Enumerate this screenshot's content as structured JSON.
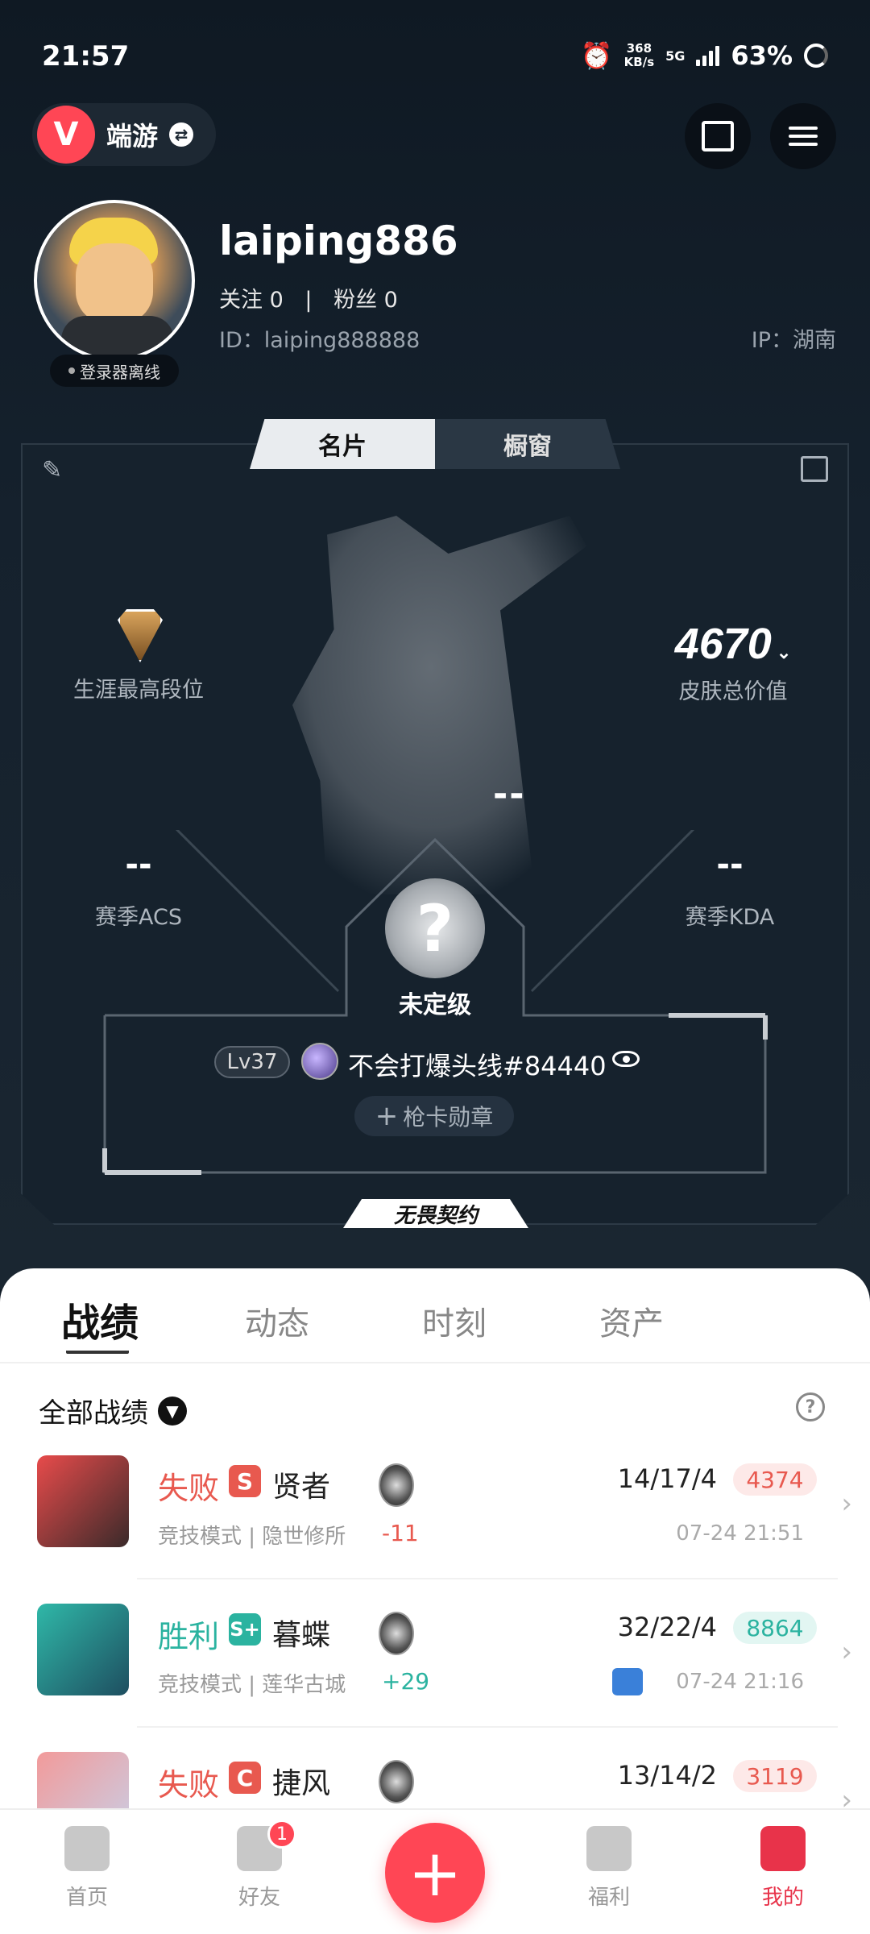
{
  "status_bar": {
    "time": "21:57",
    "net_speed_value": "368",
    "net_speed_unit": "KB/s",
    "network": "5G",
    "battery": "63%"
  },
  "header": {
    "app_name": "端游",
    "logo_icon": "valorant-logo-icon",
    "brand_color": "#ff4655"
  },
  "profile": {
    "username": "laiping886",
    "follow_label": "关注",
    "follow_count": "0",
    "separator": "|",
    "fans_label": "粉丝",
    "fans_count": "0",
    "id_text": "ID：laiping888888",
    "ip_text": "IP：湖南",
    "online_status": "登录器离线"
  },
  "card": {
    "tabs": [
      "名片",
      "橱窗"
    ],
    "active_tab": "名片",
    "career_rank_label": "生涯最高段位",
    "skin_value": "4670",
    "skin_value_label": "皮肤总价值",
    "center_dashes": "--",
    "acs_value": "--",
    "acs_label": "赛季ACS",
    "kda_value": "--",
    "kda_label": "赛季KDA",
    "rank_status_symbol": "?",
    "rank_status": "未定级",
    "level": "Lv37",
    "player_name": "不会打爆头线#84440",
    "badge_button": "枪卡勋章",
    "banner": "无畏契约"
  },
  "record_tabs": [
    "战绩",
    "动态",
    "时刻",
    "资产"
  ],
  "filter": {
    "label": "全部战绩"
  },
  "matches": [
    {
      "result": "失败",
      "tier": "S",
      "agent": "贤者",
      "mode": "竞技模式",
      "map": "隐世修所",
      "mode_map": "竞技模式 | 隐世修所",
      "rr_change": "-11",
      "kda": "14/17/4",
      "score": "4374",
      "time": "07-24 21:51",
      "has_video": false
    },
    {
      "result": "胜利",
      "tier": "S+",
      "agent": "暮蝶",
      "mode": "竞技模式",
      "map": "莲华古城",
      "mode_map": "竞技模式 | 莲华古城",
      "rr_change": "+29",
      "kda": "32/22/4",
      "score": "8864",
      "time": "07-24 21:16",
      "has_video": true
    },
    {
      "result": "失败",
      "tier": "C",
      "agent": "捷风",
      "mode_map": "",
      "rr_change": "",
      "kda": "13/14/2",
      "score": "3119",
      "time": "",
      "has_video": false
    }
  ],
  "bottom_nav": [
    {
      "label": "首页",
      "icon": "home-icon"
    },
    {
      "label": "好友",
      "icon": "friends-icon",
      "badge": "1"
    },
    {
      "label": "",
      "icon": "plus-icon"
    },
    {
      "label": "福利",
      "icon": "gift-icon"
    },
    {
      "label": "我的",
      "icon": "profile-icon",
      "active": true
    }
  ],
  "colors": {
    "loss": "#e8594f",
    "win": "#2bb3a0",
    "loss_score_bg": "#fde9e8",
    "win_score_bg": "#e2f6f2",
    "accent": "#ff4655"
  }
}
